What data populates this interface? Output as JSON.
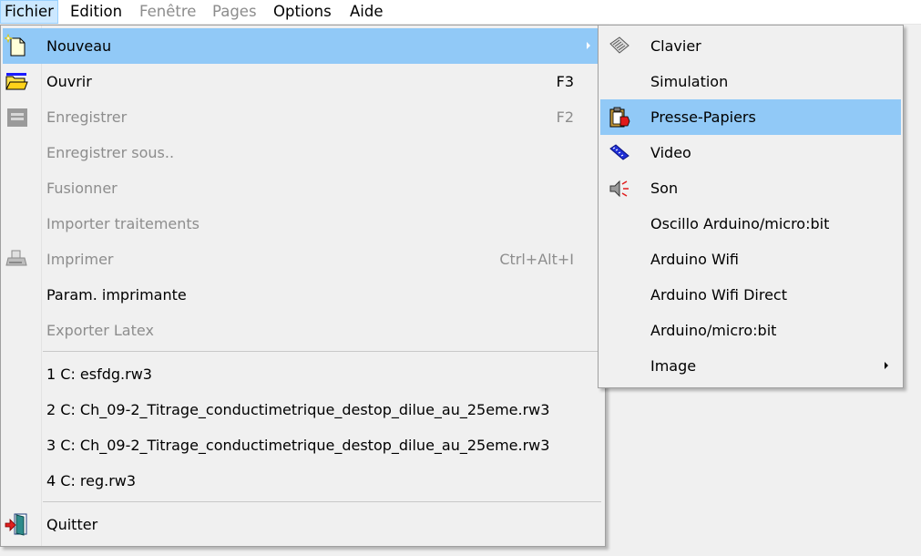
{
  "menubar": {
    "items": [
      {
        "label": "Fichier",
        "state": "active"
      },
      {
        "label": "Edition",
        "state": "enabled"
      },
      {
        "label": "Fenêtre",
        "state": "disabled"
      },
      {
        "label": "Pages",
        "state": "disabled"
      },
      {
        "label": "Options",
        "state": "enabled"
      },
      {
        "label": "Aide",
        "state": "enabled"
      }
    ]
  },
  "file_menu": {
    "items": [
      {
        "label": "Nouveau",
        "shortcut": "",
        "enabled": true,
        "highlighted": true,
        "submenu": true,
        "icon": "new-file-icon"
      },
      {
        "label": "Ouvrir",
        "shortcut": "F3",
        "enabled": true,
        "icon": "open-folder-icon"
      },
      {
        "label": "Enregistrer",
        "shortcut": "F2",
        "enabled": false,
        "icon": "save-disk-icon"
      },
      {
        "label": "Enregistrer sous..",
        "shortcut": "",
        "enabled": false
      },
      {
        "label": "Fusionner",
        "shortcut": "",
        "enabled": false
      },
      {
        "label": "Importer traitements",
        "shortcut": "",
        "enabled": false
      },
      {
        "label": "Imprimer",
        "shortcut": "Ctrl+Alt+I",
        "enabled": false,
        "icon": "printer-icon"
      },
      {
        "label": "Param. imprimante",
        "shortcut": "",
        "enabled": true
      },
      {
        "label": "Exporter Latex",
        "shortcut": "",
        "enabled": false
      }
    ],
    "recent": [
      {
        "label": "1 C: esfdg.rw3"
      },
      {
        "label": "2 C: Ch_09-2_Titrage_conductimetrique_destop_dilue_au_25eme.rw3"
      },
      {
        "label": "3 C: Ch_09-2_Titrage_conductimetrique_destop_dilue_au_25eme.rw3"
      },
      {
        "label": "4 C: reg.rw3"
      }
    ],
    "quit": {
      "label": "Quitter",
      "icon": "exit-door-icon"
    }
  },
  "submenu": {
    "items": [
      {
        "label": "Clavier",
        "icon": "keyboard-icon"
      },
      {
        "label": "Simulation"
      },
      {
        "label": "Presse-Papiers",
        "icon": "clipboard-icon",
        "highlighted": true
      },
      {
        "label": "Video",
        "icon": "film-icon"
      },
      {
        "label": "Son",
        "icon": "speaker-icon"
      },
      {
        "label": "Oscillo Arduino/micro:bit"
      },
      {
        "label": "Arduino Wifi"
      },
      {
        "label": "Arduino Wifi Direct"
      },
      {
        "label": "Arduino/micro:bit"
      },
      {
        "label": "Image",
        "submenu": true
      }
    ]
  },
  "colors": {
    "menubar_active_bg": "#cce8ff",
    "highlight_bg": "#91c9f7",
    "disabled_text": "#8d8d8d",
    "menu_bg": "#f0f0f0"
  }
}
